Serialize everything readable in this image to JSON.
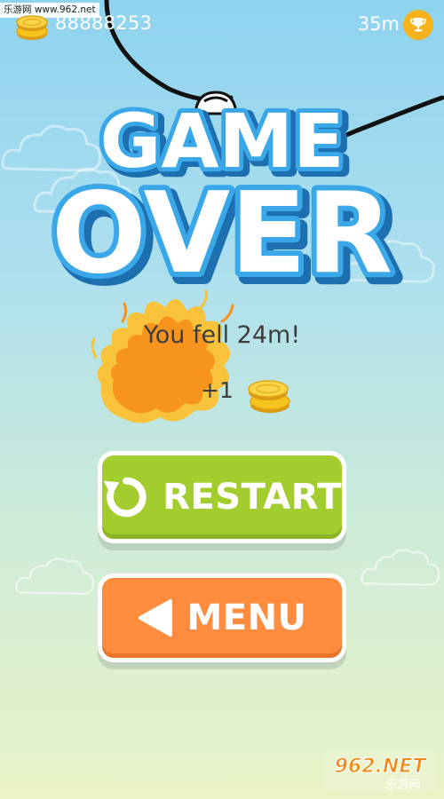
{
  "watermark_top": "乐游网 www.962.net",
  "hud": {
    "coins": "88888253",
    "best_distance": "35m",
    "coin_icon": "coin-stack-icon",
    "trophy_icon": "trophy-icon"
  },
  "title": {
    "line1": "GAME",
    "line2": "OVER"
  },
  "result": {
    "fell_text": "You fell 24m!",
    "reward_text": "+1"
  },
  "buttons": {
    "restart_label": "RESTART",
    "menu_label": "MENU"
  },
  "watermark_bottom": {
    "brand": "962.NET",
    "subtitle": "乐游网"
  },
  "colors": {
    "restart": "#a3cd2f",
    "menu": "#fd8c3f",
    "title_blue": "#3aa7e8",
    "coin": "#f7c31f",
    "fire": "#f7941d"
  }
}
